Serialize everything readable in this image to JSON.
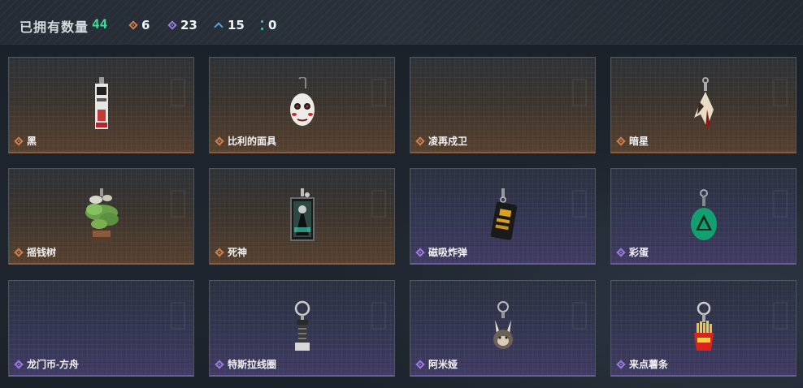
{
  "header": {
    "title": "已拥有数量",
    "total": "44",
    "stats": [
      {
        "icon": "orange-diamond-icon",
        "color": "#d0804e",
        "value": "6"
      },
      {
        "icon": "purple-diamond-icon",
        "color": "#9d7be0",
        "value": "23"
      },
      {
        "icon": "blue-chevron-icon",
        "color": "#58a0e0",
        "value": "15"
      },
      {
        "icon": "teal-dots-icon",
        "color": "#36d0b8",
        "value": "0"
      }
    ]
  },
  "cards": [
    {
      "name": "黑",
      "rarity": "orange",
      "icon": "tag-pendant-icon"
    },
    {
      "name": "比利的面具",
      "rarity": "orange",
      "icon": "puppet-mask-icon"
    },
    {
      "name": "凌再戍卫",
      "rarity": "orange",
      "icon": "empty-slot"
    },
    {
      "name": "暗星",
      "rarity": "orange",
      "icon": "blade-charm-icon"
    },
    {
      "name": "摇钱树",
      "rarity": "orange",
      "icon": "money-tree-icon"
    },
    {
      "name": "死神",
      "rarity": "orange",
      "icon": "reaper-card-icon"
    },
    {
      "name": "磁吸炸弹",
      "rarity": "purple",
      "icon": "bomb-charm-icon"
    },
    {
      "name": "彩蛋",
      "rarity": "purple",
      "icon": "green-egg-icon"
    },
    {
      "name": "龙门币-方舟",
      "rarity": "purple",
      "icon": "empty-slot"
    },
    {
      "name": "特斯拉线圈",
      "rarity": "purple",
      "icon": "tesla-coil-icon"
    },
    {
      "name": "阿米娅",
      "rarity": "purple",
      "icon": "bunny-plush-icon"
    },
    {
      "name": "来点薯条",
      "rarity": "purple",
      "icon": "fries-charm-icon"
    }
  ],
  "colors": {
    "orange": "#d0804e",
    "purple": "#9d7be0"
  }
}
